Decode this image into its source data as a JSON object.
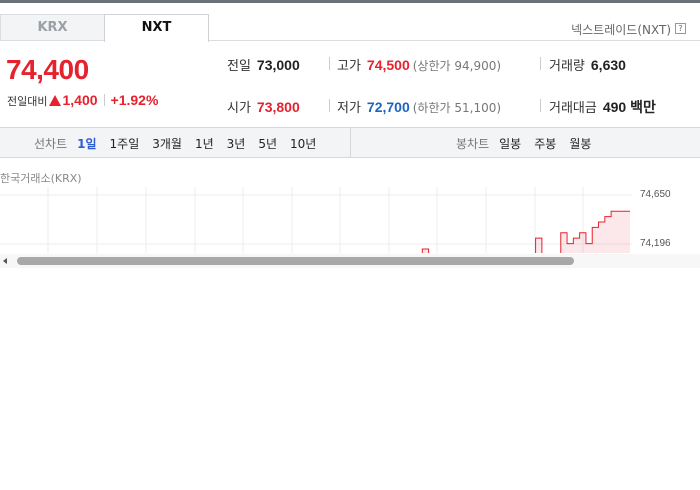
{
  "tabs": [
    {
      "label": "KRX",
      "active": false
    },
    {
      "label": "NXT",
      "active": true
    }
  ],
  "exchange_label": "넥스트레이드(NXT)",
  "help_glyph": "?",
  "quote": {
    "price": "74,400",
    "change_label": "전일대비",
    "change": "1,400",
    "change_pct": "+1.92%",
    "direction": "up"
  },
  "stats": {
    "prev_close": {
      "label": "전일",
      "value": "73,000"
    },
    "high": {
      "label": "고가",
      "value": "74,500",
      "sub": "(상한가 94,900)"
    },
    "volume": {
      "label": "거래량",
      "value": "6,630"
    },
    "open": {
      "label": "시가",
      "value": "73,800"
    },
    "low": {
      "label": "저가",
      "value": "72,700",
      "sub": "(하한가 51,100)"
    },
    "amount": {
      "label": "거래대금",
      "value": "490 백만"
    }
  },
  "chart_toolbar": {
    "line_title": "선차트",
    "line_options": [
      "1일",
      "1주일",
      "3개월",
      "1년",
      "3년",
      "5년",
      "10년"
    ],
    "line_selected": "1일",
    "candle_title": "봉차트",
    "candle_options": [
      "일봉",
      "주봉",
      "월봉"
    ]
  },
  "chart_source": "한국거래소(KRX)",
  "colors": {
    "up": "#e5222d",
    "down": "#1c63c2",
    "accent": "#2d5bd3"
  },
  "chart_data": {
    "type": "line",
    "title": "",
    "y_tick_labels": [
      "74,650",
      "74,196"
    ],
    "ylim_visible": [
      74196,
      74650
    ],
    "grid": true,
    "series": [
      {
        "values": [
          74000,
          74150,
          74000,
          74100,
          74000,
          74050,
          74000,
          74100,
          74000,
          74050,
          74000,
          74050,
          74000,
          74000,
          74050,
          74000,
          74100,
          74050,
          74000,
          74250,
          74100,
          74050,
          74100,
          74300,
          74200,
          74250,
          74300,
          74200,
          74350,
          74400,
          74450,
          74500,
          74500,
          74500,
          74500
        ]
      }
    ]
  }
}
